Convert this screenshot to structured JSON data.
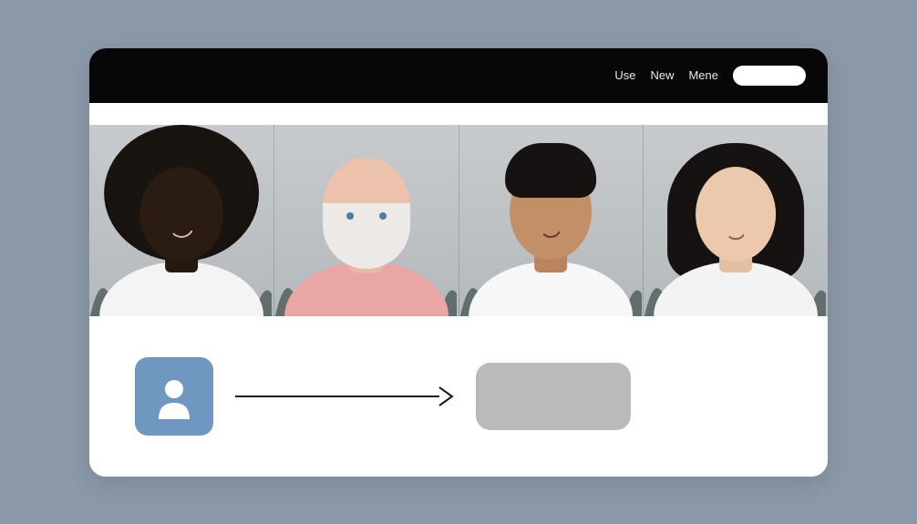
{
  "nav": {
    "items": [
      "Use",
      "New",
      "Mene"
    ]
  },
  "people": [
    {
      "name": "person-1"
    },
    {
      "name": "person-2"
    },
    {
      "name": "person-3"
    },
    {
      "name": "person-4"
    }
  ],
  "icons": {
    "avatar": "person-icon",
    "arrow": "arrow-right-icon"
  },
  "colors": {
    "page_bg": "#8b99a8",
    "header_bg": "#070707",
    "avatar_bg": "#6f97bf",
    "target_bg": "#b9bab9"
  }
}
